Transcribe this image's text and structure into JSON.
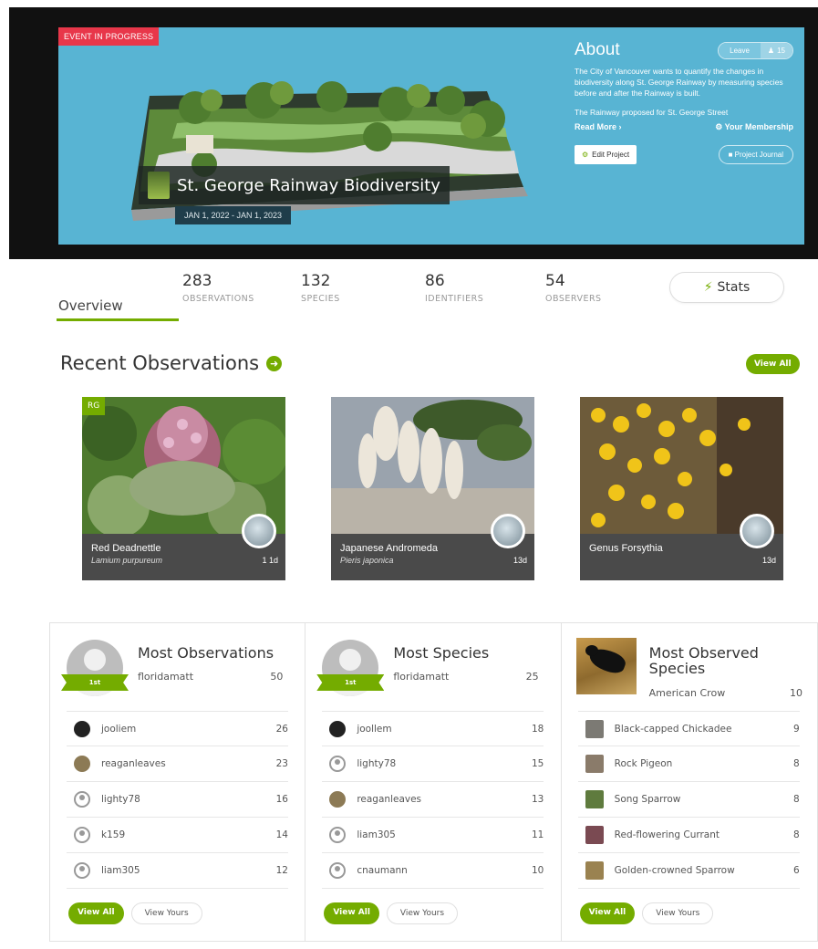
{
  "project": {
    "event_badge": "EVENT IN PROGRESS",
    "title": "St. George Rainway Biodiversity",
    "dates": "JAN 1, 2022 - JAN 1, 2023"
  },
  "about": {
    "title": "About",
    "leave_label": "Leave",
    "members_label": "15",
    "description": "The City of Vancouver wants to quantify the changes in biodiversity along St. George Rainway by measuring species before and after the Rainway is built.",
    "note": "The Rainway proposed for St. George Street",
    "read_more": "Read More ›",
    "membership": "Your Membership",
    "edit_project": "Edit Project",
    "project_journal": "Project Journal"
  },
  "tabs": {
    "overview": "Overview",
    "stats": [
      {
        "num": "283",
        "label": "OBSERVATIONS"
      },
      {
        "num": "132",
        "label": "SPECIES"
      },
      {
        "num": "86",
        "label": "IDENTIFIERS"
      },
      {
        "num": "54",
        "label": "OBSERVERS"
      }
    ],
    "stats_button": "Stats"
  },
  "recent": {
    "title": "Recent Observations",
    "view_all": "View All",
    "cards": [
      {
        "name": "Red Deadnettle",
        "sci": "Lamium purpureum",
        "meta": "1 1d",
        "badge": "RG"
      },
      {
        "name": "Japanese Andromeda",
        "sci": "Pieris japonica",
        "meta": "13d"
      },
      {
        "name": "Genus Forsythia",
        "sci": "",
        "meta": "13d"
      }
    ]
  },
  "boards": [
    {
      "title": "Most Observations",
      "ribbon": "1st",
      "top_user": "floridamatt",
      "top_count": "50",
      "rows": [
        {
          "name": "jooliem",
          "count": "26"
        },
        {
          "name": "reaganleaves",
          "count": "23"
        },
        {
          "name": "lighty78",
          "count": "16"
        },
        {
          "name": "k159",
          "count": "14"
        },
        {
          "name": "liam305",
          "count": "12"
        }
      ],
      "view_all": "View All",
      "view_yours": "View Yours"
    },
    {
      "title": "Most Species",
      "ribbon": "1st",
      "top_user": "floridamatt",
      "top_count": "25",
      "rows": [
        {
          "name": "joollem",
          "count": "18"
        },
        {
          "name": "lighty78",
          "count": "15"
        },
        {
          "name": "reaganleaves",
          "count": "13"
        },
        {
          "name": "liam305",
          "count": "11"
        },
        {
          "name": "cnaumann",
          "count": "10"
        }
      ],
      "view_all": "View All",
      "view_yours": "View Yours"
    },
    {
      "title": "Most Observed Species",
      "top_user": "American Crow",
      "top_count": "10",
      "rows": [
        {
          "name": "Black-capped Chickadee",
          "count": "9"
        },
        {
          "name": "Rock Pigeon",
          "count": "8"
        },
        {
          "name": "Song Sparrow",
          "count": "8"
        },
        {
          "name": "Red-flowering Currant",
          "count": "8"
        },
        {
          "name": "Golden-crowned Sparrow",
          "count": "6"
        }
      ],
      "view_all": "View All",
      "view_yours": "View Yours"
    }
  ],
  "colors": {
    "accent_green": "#74ac00",
    "banner_blue": "#58b4d3",
    "event_red": "#e8374a"
  }
}
